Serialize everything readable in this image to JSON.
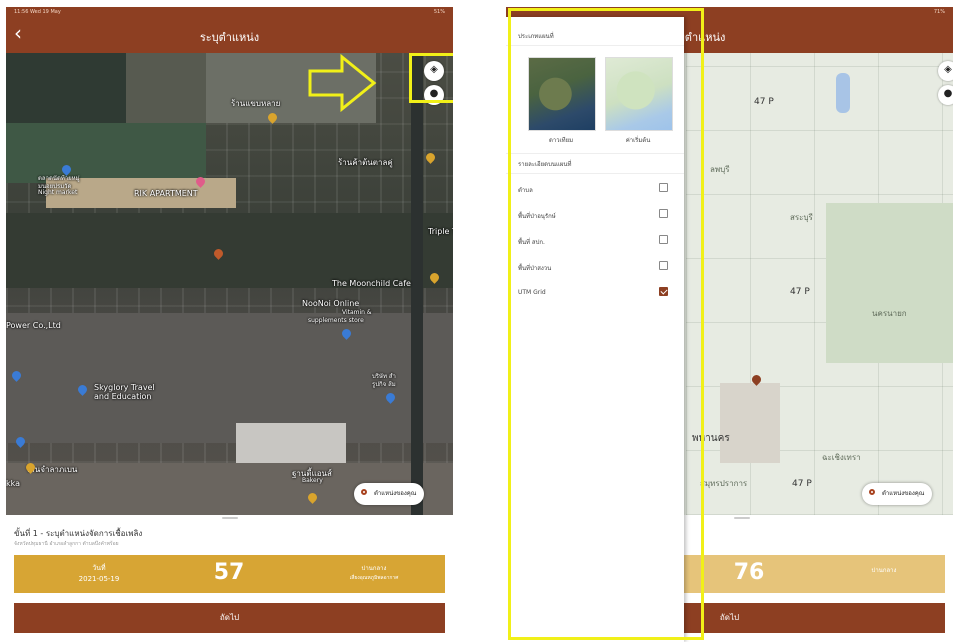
{
  "left_screen": {
    "status_bar": {
      "time_date": "11:56 Wed 19 May",
      "battery": "51%"
    },
    "nav_title": "ระบุตำแหน่ง",
    "back_icon": "chevron-left",
    "map_labels": {
      "restaurant": "ร้านแขบหลาย",
      "market_1": "ตลาดนัดท้ายหมู่",
      "market_2": "มนอยปรมวัด",
      "market_en": "Night market",
      "rik": "RIK APARTMENT",
      "shop": "ร้านค้าต้นตาลคู่",
      "triple": "Triple T",
      "moonchild": "The Moonchild Cafe",
      "noonoi": "NooNoi Online",
      "noonoi_sub1": "Vitamin &",
      "noonoi_sub2": "supplements store",
      "power": "Power Co.,Ltd",
      "skyglory1": "Skyglory Travel",
      "skyglory2": "and Education",
      "company": "บริษัท สำ",
      "company2": "รูปกิจ ส้ม",
      "bakery": "ฐานตี้แอนส์",
      "bakery_en": "Bakery",
      "kka": "kka",
      "thai_shop": "ร้านจำลาภเบน"
    },
    "layers_icon": "layers-icon",
    "location_icon": "location-pin-icon",
    "my_location_label": "ตำแหน่งของคุณ",
    "step_title": "ขั้นที่ 1 - ระบุตำแหน่งจัดการเชื้อเพลิง",
    "step_subtitle": "จังหวัดปทุมธานี อำเภอลำลูกกา ตำบลบึงคำพร้อย",
    "info": {
      "date_label": "วันที่",
      "date_value": "2021-05-19",
      "big_number": "57",
      "level_label": "ปานกลาง",
      "level_sub": "เสี่ยงอุณหภูมิพลอากาศ"
    },
    "next_label": "ถัดไป"
  },
  "right_screen": {
    "nav_title": "ระบุตำแหน่ง",
    "battery": "71%",
    "panel": {
      "map_type_title": "ประเภทแผนที่",
      "map_types": [
        {
          "label": "ดาวเทียม"
        },
        {
          "label": "ค่าเริ่มต้น"
        }
      ],
      "details_title": "รายละเอียดบนแผนที่",
      "options": [
        {
          "label": "ตำบล",
          "checked": false
        },
        {
          "label": "พื้นที่ป่าอนุรักษ์",
          "checked": false
        },
        {
          "label": "พื้นที่ สปก.",
          "checked": false
        },
        {
          "label": "พื้นที่ป่าสงวน",
          "checked": false
        },
        {
          "label": "UTM Grid",
          "checked": true
        }
      ]
    },
    "map_labels": {
      "p47_1": "47 P",
      "p47_2": "47 P",
      "p47_3": "47 P",
      "lopburi": "ลพบุรี",
      "saraburi": "สระบุรี",
      "nakhonnayok": "นครนายก",
      "bangkok": "พหานคร",
      "chachoengsao": "ฉะเชิงเทรา",
      "samutprakan": "สมุทรปราการ"
    },
    "my_location_label": "ตำแหน่งของคุณ",
    "big_number": "76",
    "level_label": "ปานกลาง",
    "next_label": "ถัดไป"
  },
  "colors": {
    "brand_brown": "#8d3f22",
    "gold": "#d7a534",
    "highlight_yellow": "#f1f018"
  }
}
